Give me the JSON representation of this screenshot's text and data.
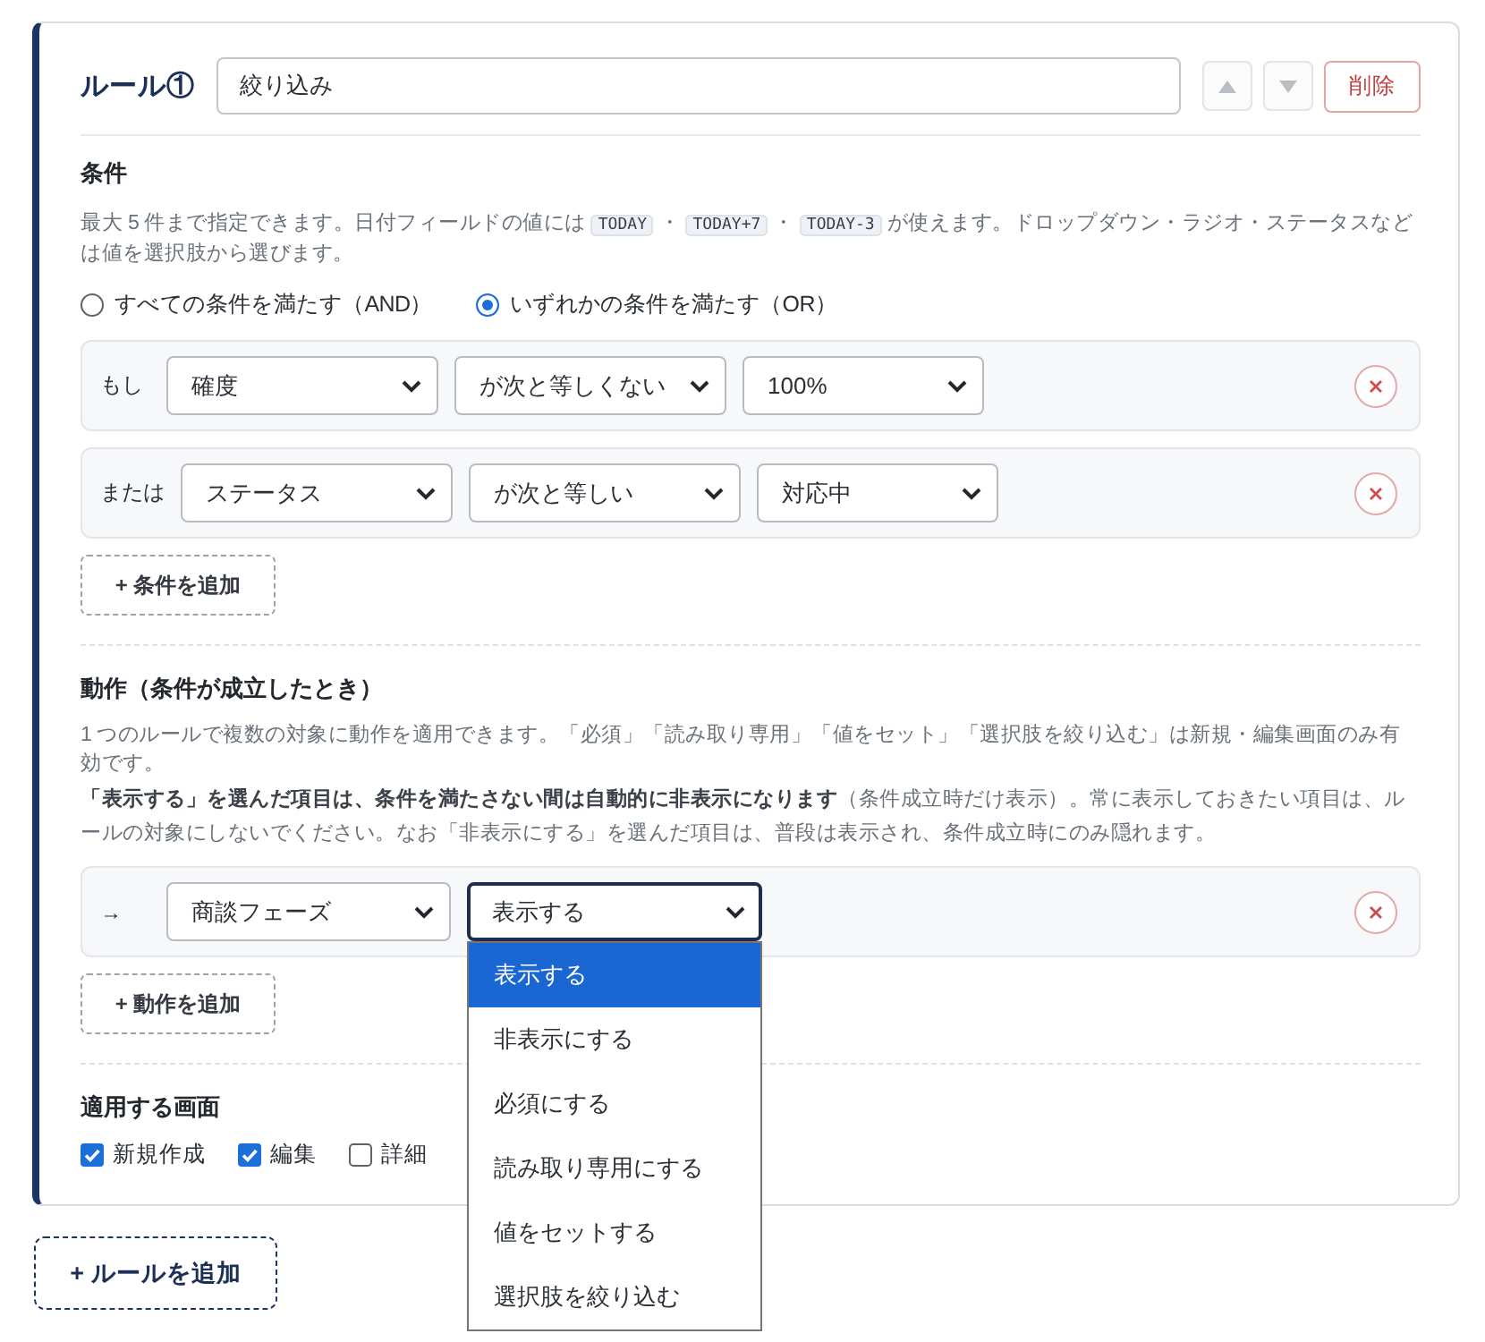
{
  "rule": {
    "title": "ルール①",
    "name": "絞り込み",
    "move_up": {
      "disabled": true
    },
    "move_down": {
      "disabled": true
    },
    "delete_label": "削除"
  },
  "conditions": {
    "heading": "条件",
    "description": [
      {
        "kind": "text",
        "text": "最大 5 件まで指定できます。日付フィールドの値には"
      },
      {
        "kind": "code",
        "text": "TODAY"
      },
      {
        "kind": "text",
        "text": "・"
      },
      {
        "kind": "code",
        "text": "TODAY+7"
      },
      {
        "kind": "text",
        "text": "・"
      },
      {
        "kind": "code",
        "text": "TODAY-3"
      },
      {
        "kind": "text",
        "text": "が使えます。ドロップダウン・ラジオ・ステータスなどは値を選択肢から選びます。"
      }
    ],
    "match_options": [
      {
        "label": "すべての条件を満たす（AND）",
        "selected": false
      },
      {
        "label": "いずれかの条件を満たす（OR）",
        "selected": true
      }
    ],
    "rows": [
      {
        "prefix": "もし",
        "field": "確度",
        "operator": "が次と等しくない",
        "value": "100%"
      },
      {
        "prefix": "または",
        "field": "ステータス",
        "operator": "が次と等しい",
        "value": "対応中"
      }
    ],
    "add_label": "+ 条件を追加"
  },
  "actions": {
    "heading": "動作（条件が成立したとき）",
    "paragraphs": [
      "1 つのルールで複数の対象に動作を適用できます。「必須」「読み取り専用」「値をセット」「選択肢を絞り込む」は新規・編集画面のみ有効です。",
      "**「表示する」を選んだ項目は、条件を満たさない間は自動的に非表示になります**（条件成立時だけ表示）。常に表示しておきたい項目は、ルールの対象にしないでください。なお「非表示にする」を選んだ項目は、普段は表示され、条件成立時にのみ隠れます。"
    ],
    "rows": [
      {
        "prefix": "→",
        "field": "商談フェーズ",
        "action": "表示する",
        "open": true,
        "options": [
          {
            "label": "表示する",
            "selected": true
          },
          {
            "label": "非表示にする",
            "selected": false
          },
          {
            "label": "必須にする",
            "selected": false
          },
          {
            "label": "読み取り専用にする",
            "selected": false
          },
          {
            "label": "値をセットする",
            "selected": false
          },
          {
            "label": "選択肢を絞り込む",
            "selected": false
          }
        ]
      }
    ],
    "add_label": "+ 動作を追加"
  },
  "screens": {
    "heading": "適用する画面",
    "items": [
      {
        "label": "新規作成",
        "checked": true
      },
      {
        "label": "編集",
        "checked": true
      },
      {
        "label": "詳細",
        "checked": false
      }
    ]
  },
  "add_rule_label": "+ ルールを追加"
}
